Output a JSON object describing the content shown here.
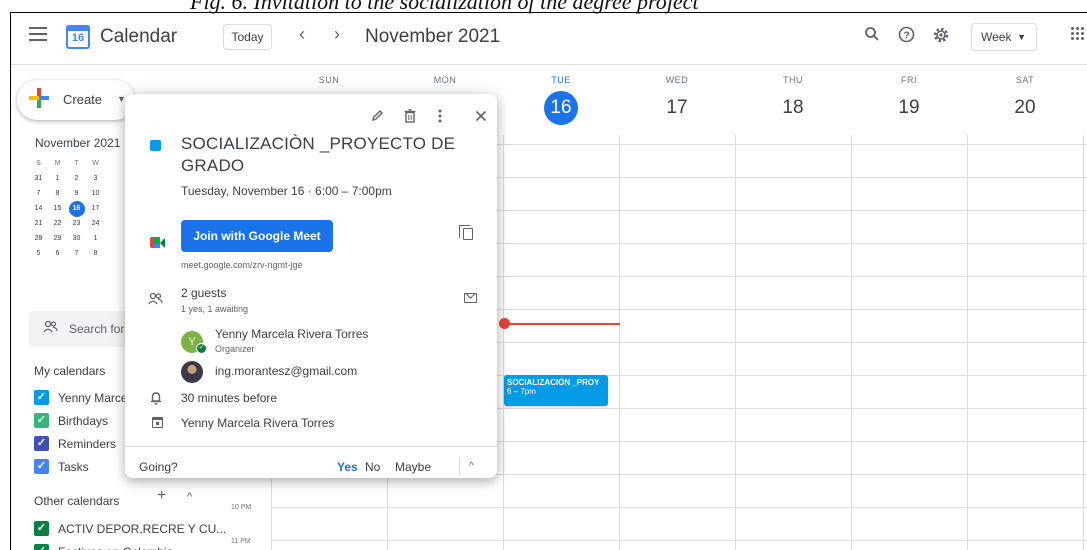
{
  "page_caption": "Fig. 6. Invitation to the socialization of the degree project",
  "header": {
    "brand": "Calendar",
    "logo_day": "16",
    "today_label": "Today",
    "prev_label": "‹",
    "next_label": "›",
    "month_title": "November 2021",
    "view_label": "Week",
    "icons": [
      "menu-icon",
      "search-icon",
      "help-icon",
      "settings-icon",
      "apps-icon"
    ]
  },
  "sidebar": {
    "create_label": "Create",
    "mini_calendar": {
      "title": "November 2021",
      "weekdays": [
        "S",
        "M",
        "T",
        "W"
      ],
      "weeks": [
        [
          "31",
          "1",
          "2",
          "3"
        ],
        [
          "7",
          "8",
          "9",
          "10"
        ],
        [
          "14",
          "15",
          "16",
          "17"
        ],
        [
          "21",
          "22",
          "23",
          "24"
        ],
        [
          "28",
          "29",
          "30",
          "1"
        ],
        [
          "5",
          "6",
          "7",
          "8"
        ]
      ],
      "selected": "16"
    },
    "search_people": "Search for",
    "my_calendars_title": "My calendars",
    "my_calendars": [
      {
        "label": "Yenny Marce",
        "color": "#039be5"
      },
      {
        "label": "Birthdays",
        "color": "#33b679"
      },
      {
        "label": "Reminders",
        "color": "#3f51b5"
      },
      {
        "label": "Tasks",
        "color": "#4285f4"
      }
    ],
    "other_calendars_title": "Other calendars",
    "other_calendars": [
      {
        "label": "ACTIV DEPOR,RECRE Y CU...",
        "color": "#0b8043"
      },
      {
        "label": "Festivos en Colombia",
        "color": "#0b8043"
      }
    ]
  },
  "week": {
    "days": [
      {
        "name": "SUN",
        "num": ""
      },
      {
        "name": "MON",
        "num": ""
      },
      {
        "name": "TUE",
        "num": "16"
      },
      {
        "name": "WED",
        "num": "17"
      },
      {
        "name": "THU",
        "num": "18"
      },
      {
        "name": "FRI",
        "num": "19"
      },
      {
        "name": "SAT",
        "num": "20"
      }
    ],
    "active_day": "16",
    "time_labels": [
      "10 PM",
      "11 PM"
    ],
    "event_chip": {
      "title": "SOCIALIZACIÒN _PROY",
      "time": "6 – 7pm",
      "color": "#039be5"
    },
    "now_indicator_color": "#ea4335"
  },
  "popup": {
    "title": "SOCIALIZACIÒN _PROYECTO DE GRADO",
    "datetime": "Tuesday, November 16  ·  6:00 – 7:00pm",
    "meet_button": "Join with Google Meet",
    "meet_link": "meet.google.com/zrv-ngmt-jge",
    "guests_title": "2 guests",
    "guests_summary": "1 yes, 1 awaiting",
    "guests": [
      {
        "name": "Yenny Marcela Rivera Torres",
        "role": "Organizer",
        "initial": "Y"
      },
      {
        "name": "ing.morantesz@gmail.com",
        "role": ""
      }
    ],
    "reminder": "30 minutes before",
    "owner": "Yenny Marcela Rivera Torres",
    "going_label": "Going?",
    "rsvp": {
      "yes": "Yes",
      "no": "No",
      "maybe": "Maybe"
    },
    "accent": "#1a73e8"
  }
}
